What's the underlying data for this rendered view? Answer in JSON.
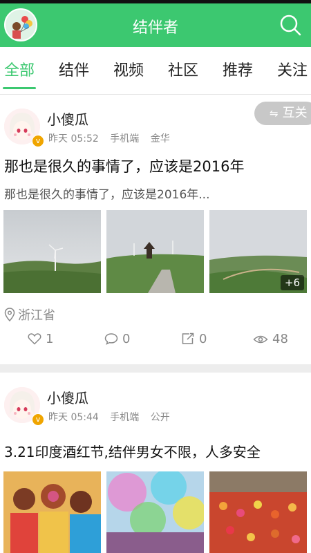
{
  "header": {
    "title": "结伴者"
  },
  "tabs": [
    {
      "label": "全部",
      "active": true
    },
    {
      "label": "结伴",
      "active": false
    },
    {
      "label": "视频",
      "active": false
    },
    {
      "label": "社区",
      "active": false
    },
    {
      "label": "推荐",
      "active": false
    },
    {
      "label": "关注",
      "active": false
    }
  ],
  "posts": [
    {
      "user": "小傻瓜",
      "time": "昨天 05:52",
      "device": "手机端",
      "tag": "金华",
      "follow_label": "互关",
      "title": "那也是很久的事情了，应该是2016年",
      "excerpt": "那也是很久的事情了，应该是2016年...",
      "more_photos": "+6",
      "location": "浙江省",
      "likes": "1",
      "comments": "0",
      "shares": "0",
      "views": "48"
    },
    {
      "user": "小傻瓜",
      "time": "昨天 05:44",
      "device": "手机端",
      "tag": "公开",
      "title": "3.21印度酒红节,结伴男女不限，人多安全"
    }
  ],
  "colors": {
    "accent": "#3cc870",
    "badge": "#f0a500"
  },
  "icons": [
    "search-icon",
    "location-pin-icon",
    "heart-icon",
    "comment-icon",
    "share-icon",
    "eye-icon",
    "mutual-follow-icon",
    "verified-badge-icon"
  ]
}
